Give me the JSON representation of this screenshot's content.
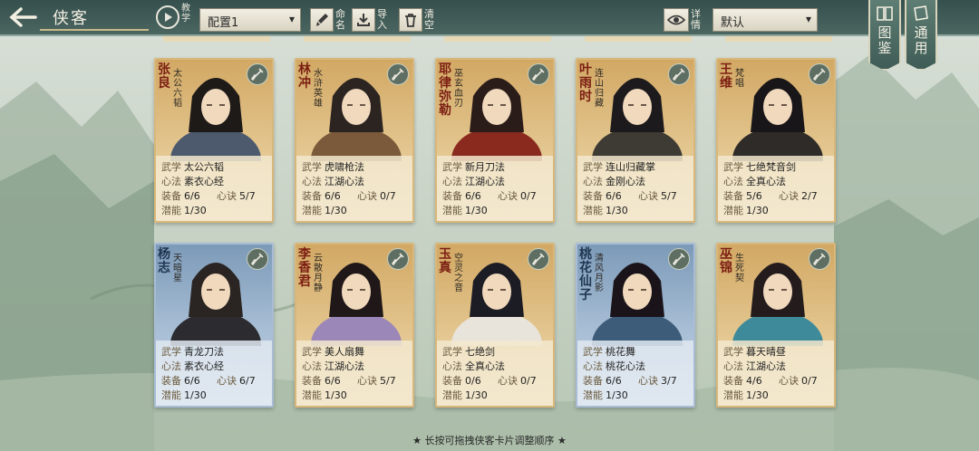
{
  "header": {
    "title": "侠客",
    "tutorial_label": "教学",
    "config_value": "配置1",
    "rename_label": "命名",
    "import_label": "导入",
    "clear_label": "清空",
    "detail_label": "详情",
    "sort_value": "默认",
    "codex_label": "图鉴",
    "general_label": "通用"
  },
  "card_labels": {
    "martial": "武学",
    "mind": "心法",
    "equip": "装备",
    "formula": "心诀",
    "potential": "潜能"
  },
  "cards": [
    {
      "name": "张良",
      "title": "太公六韬",
      "martial": "太公六韬",
      "mind": "素衣心经",
      "equip": "6/6",
      "formula": "5/7",
      "potential": "1/30",
      "theme": "gold"
    },
    {
      "name": "林冲",
      "title": "水浒英雄",
      "martial": "虎啸枪法",
      "mind": "江湖心法",
      "equip": "6/6",
      "formula": "0/7",
      "potential": "1/30",
      "theme": "gold"
    },
    {
      "name": "耶律弥勒",
      "title": "巫玄血刃",
      "martial": "新月刀法",
      "mind": "江湖心法",
      "equip": "6/6",
      "formula": "0/7",
      "potential": "1/30",
      "theme": "gold"
    },
    {
      "name": "叶雨时",
      "title": "连山归藏",
      "martial": "连山归藏掌",
      "mind": "金刚心法",
      "equip": "6/6",
      "formula": "5/7",
      "potential": "1/30",
      "theme": "gold"
    },
    {
      "name": "王维",
      "title": "梵唱",
      "martial": "七绝梵音剑",
      "mind": "全真心法",
      "equip": "5/6",
      "formula": "2/7",
      "potential": "1/30",
      "theme": "gold"
    },
    {
      "name": "杨志",
      "title": "天暗星",
      "martial": "青龙刀法",
      "mind": "素衣心经",
      "equip": "6/6",
      "formula": "6/7",
      "potential": "1/30",
      "theme": "blue"
    },
    {
      "name": "李香君",
      "title": "云散月静",
      "martial": "美人扇舞",
      "mind": "江湖心法",
      "equip": "6/6",
      "formula": "5/7",
      "potential": "1/30",
      "theme": "gold"
    },
    {
      "name": "玉真",
      "title": "空灵之音",
      "martial": "七绝剑",
      "mind": "全真心法",
      "equip": "0/6",
      "formula": "0/7",
      "potential": "1/30",
      "theme": "gold"
    },
    {
      "name": "桃花仙子",
      "title": "清风月影",
      "martial": "桃花舞",
      "mind": "桃花心法",
      "equip": "6/6",
      "formula": "3/7",
      "potential": "1/30",
      "theme": "blue"
    },
    {
      "name": "巫锦",
      "title": "生死契",
      "martial": "暮天晴昼",
      "mind": "江湖心法",
      "equip": "4/6",
      "formula": "0/7",
      "potential": "1/30",
      "theme": "gold"
    }
  ],
  "footer": {
    "hint": "★ 长按可拖拽侠客卡片调整顺序 ★"
  },
  "colors": {
    "header_bg": "#2c4846",
    "gold_card": "#d2a864",
    "blue_card": "#7c9ab8",
    "name_red": "#7b1e12"
  }
}
